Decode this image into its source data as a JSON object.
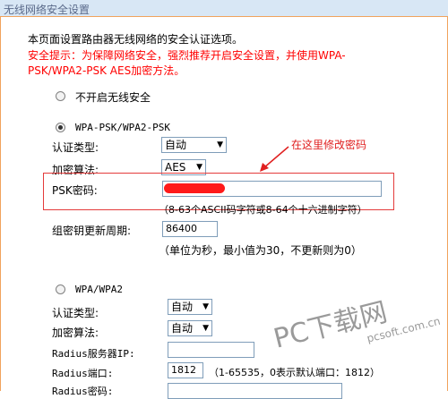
{
  "window": {
    "title": "无线网络安全设置"
  },
  "intro": {
    "line1": "本页面设置路由器无线网络的安全认证选项。",
    "warn1": "安全提示：为保障网络安全，强烈推荐开启安全设置，并使用WPA-",
    "warn2": "PSK/WPA2-PSK AES加密方法。"
  },
  "mode_none": {
    "label": "不开启无线安全",
    "selected": false
  },
  "mode_psk": {
    "label": "WPA-PSK/WPA2-PSK",
    "selected": true,
    "auth_label": "认证类型:",
    "auth_value": "自动",
    "enc_label": "加密算法:",
    "enc_value": "AES",
    "psk_label": "PSK密码:",
    "psk_value": "",
    "psk_hint": "（8-63个ASCII码字符或8-64个十六进制字符）",
    "renew_label": "组密钥更新周期:",
    "renew_value": "86400",
    "renew_hint": "（单位为秒，最小值为30，不更新则为0）"
  },
  "annotation": {
    "text": "在这里修改密码",
    "color": "#e02020"
  },
  "mode_wpa": {
    "label": "WPA/WPA2",
    "selected": false,
    "auth_label": "认证类型:",
    "auth_value": "自动",
    "enc_label": "加密算法:",
    "enc_value": "自动",
    "radius_ip_label": "Radius服务器IP:",
    "radius_ip_value": "",
    "radius_port_label": "Radius端口:",
    "radius_port_value": "1812",
    "radius_port_hint": "（1-65535，0表示默认端口：1812）",
    "radius_pwd_label": "Radius密码:"
  },
  "watermark": {
    "main": "PC下载网",
    "sub": "pcsoft.com.cn"
  },
  "colors": {
    "header_bg": "#d8e7f5",
    "frame": "#f1a35d",
    "warning": "#ff0000",
    "highlight": "#e43b3b"
  }
}
